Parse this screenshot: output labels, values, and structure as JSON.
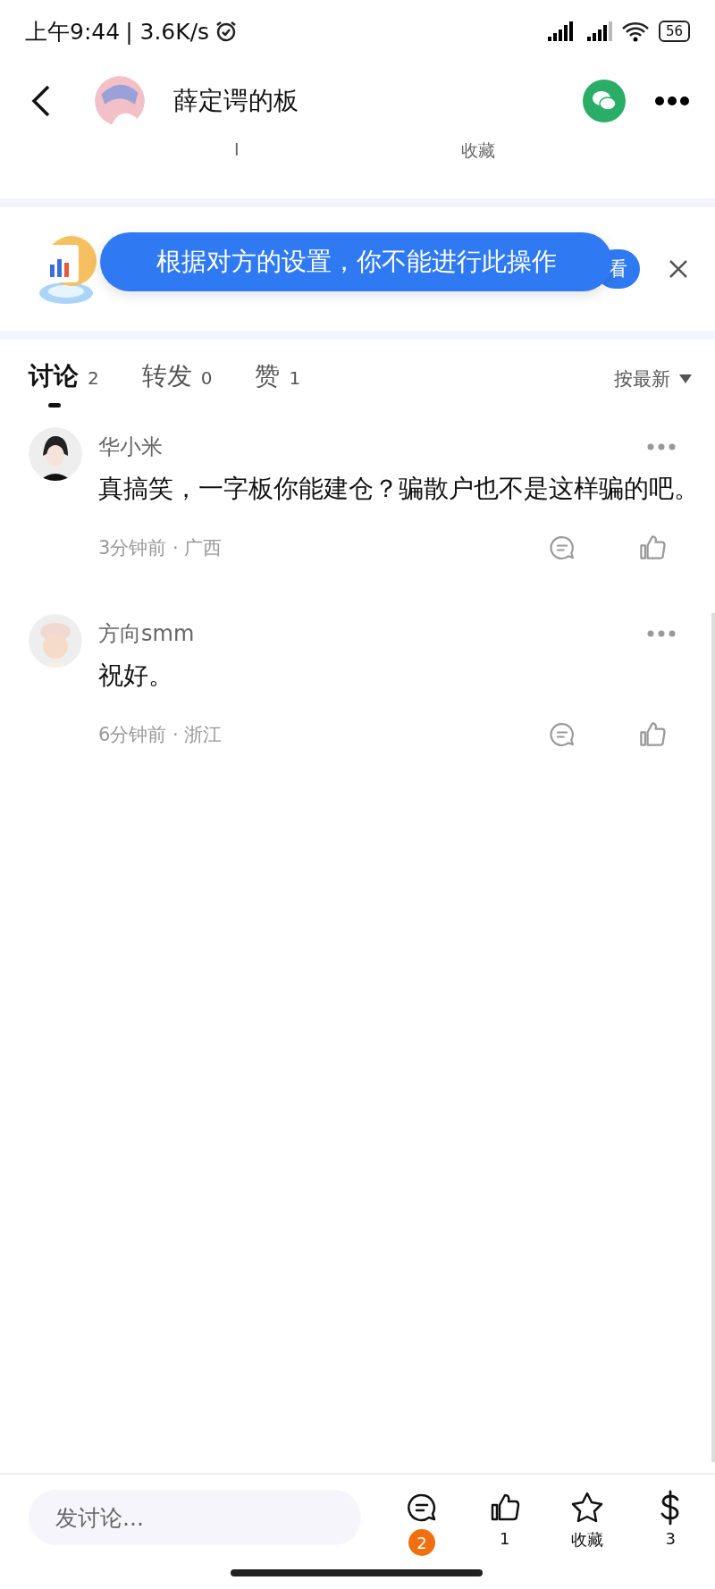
{
  "status_bar": {
    "time": "上午9:44",
    "speed": "| 3.6K/s",
    "battery": "56"
  },
  "header": {
    "title": "薛定谔的板",
    "sub_tabs": [
      {
        "label": "I"
      },
      {
        "label": "收藏"
      }
    ]
  },
  "banner": {
    "button": "看"
  },
  "toast": {
    "text": "根据对方的设置，你不能进行此操作"
  },
  "tabs": [
    {
      "label": "讨论",
      "count": "2",
      "selected": true
    },
    {
      "label": "转发",
      "count": "0",
      "selected": false
    },
    {
      "label": "赞",
      "count": "1",
      "selected": false
    }
  ],
  "sort": {
    "label": "按最新"
  },
  "comments": [
    {
      "author": "华小米",
      "text": "真搞笑，一字板你能建仓？骗散户也不是这样骗的吧。",
      "meta": "3分钟前 · 广西"
    },
    {
      "author": "方向smm",
      "text": "祝好。",
      "meta": "6分钟前 · 浙江"
    }
  ],
  "bottom_bar": {
    "placeholder": "发讨论...",
    "comment_count": "2",
    "like_count": "1",
    "favorite_label": "收藏",
    "reward_count": "3"
  }
}
